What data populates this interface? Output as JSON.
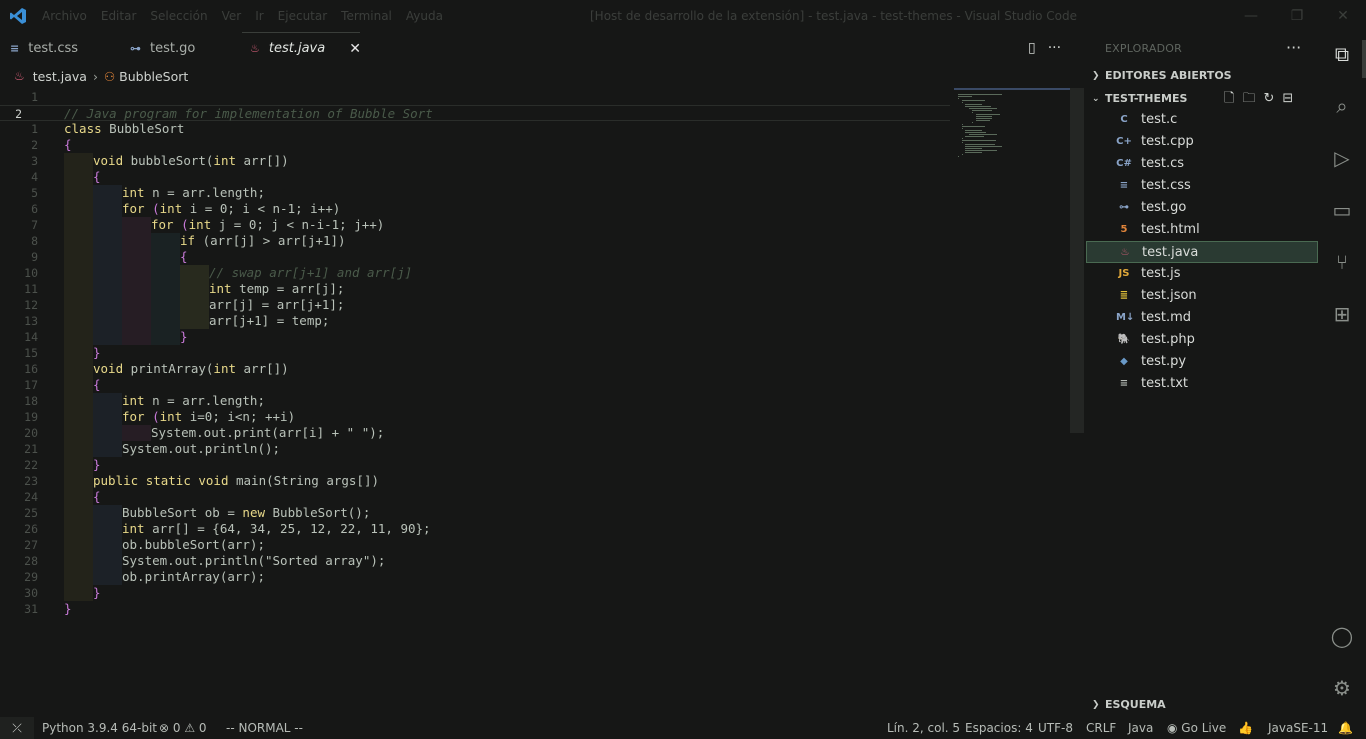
{
  "titlebar": {
    "menu": [
      "Archivo",
      "Editar",
      "Selección",
      "Ver",
      "Ir",
      "Ejecutar",
      "Terminal",
      "Ayuda"
    ],
    "title": "[Host de desarrollo de la extensión] - test.java - test-themes - Visual Studio Code",
    "min": "—",
    "max": "❐",
    "close": "✕"
  },
  "tabs": [
    {
      "label": "test.css",
      "icon": "≡"
    },
    {
      "label": "test.go",
      "icon": "⊶"
    },
    {
      "label": "test.java",
      "icon": "♨",
      "close": "✕"
    }
  ],
  "editor_actions": {
    "split": "▯",
    "more": "···"
  },
  "breadcrumb": {
    "file": "test.java",
    "symbol": "BubbleSort",
    "sep": "›"
  },
  "code": {
    "lines": [
      {
        "n": "1",
        "t": ""
      },
      {
        "n": "2",
        "t": "// Java program for implementation of Bubble Sort"
      },
      {
        "n": "1",
        "t": "class BubbleSort"
      },
      {
        "n": "2",
        "t": "{"
      },
      {
        "n": "3",
        "t": "    void bubbleSort(int arr[])"
      },
      {
        "n": "4",
        "t": "    {"
      },
      {
        "n": "5",
        "t": "        int n = arr.length;"
      },
      {
        "n": "6",
        "t": "        for (int i = 0; i < n-1; i++)"
      },
      {
        "n": "7",
        "t": "            for (int j = 0; j < n-i-1; j++)"
      },
      {
        "n": "8",
        "t": "                if (arr[j] > arr[j+1])"
      },
      {
        "n": "9",
        "t": "                {"
      },
      {
        "n": "10",
        "t": "                    // swap arr[j+1] and arr[j]"
      },
      {
        "n": "11",
        "t": "                    int temp = arr[j];"
      },
      {
        "n": "12",
        "t": "                    arr[j] = arr[j+1];"
      },
      {
        "n": "13",
        "t": "                    arr[j+1] = temp;"
      },
      {
        "n": "14",
        "t": "                }"
      },
      {
        "n": "15",
        "t": "    }"
      },
      {
        "n": "16",
        "t": "    void printArray(int arr[])"
      },
      {
        "n": "17",
        "t": "    {"
      },
      {
        "n": "18",
        "t": "        int n = arr.length;"
      },
      {
        "n": "19",
        "t": "        for (int i=0; i<n; ++i)"
      },
      {
        "n": "20",
        "t": "            System.out.print(arr[i] + \" \");"
      },
      {
        "n": "21",
        "t": "        System.out.println();"
      },
      {
        "n": "22",
        "t": "    }"
      },
      {
        "n": "23",
        "t": "    public static void main(String args[])"
      },
      {
        "n": "24",
        "t": "    {"
      },
      {
        "n": "25",
        "t": "        BubbleSort ob = new BubbleSort();"
      },
      {
        "n": "26",
        "t": "        int arr[] = {64, 34, 25, 12, 22, 11, 90};"
      },
      {
        "n": "27",
        "t": "        ob.bubbleSort(arr);"
      },
      {
        "n": "28",
        "t": "        System.out.println(\"Sorted array\");"
      },
      {
        "n": "29",
        "t": "        ob.printArray(arr);"
      },
      {
        "n": "30",
        "t": "    }"
      },
      {
        "n": "31",
        "t": "}"
      }
    ]
  },
  "sidebar": {
    "title": "EXPLORADOR",
    "more": "···",
    "open_editors": "EDITORES ABIERTOS",
    "workspace": "TEST-THEMES",
    "outline": "ESQUEMA",
    "files": [
      {
        "name": "test.c",
        "icon": "C",
        "color": "#8aa4c8"
      },
      {
        "name": "test.cpp",
        "icon": "C+",
        "color": "#8aa4c8"
      },
      {
        "name": "test.cs",
        "icon": "C#",
        "color": "#8aa4c8"
      },
      {
        "name": "test.css",
        "icon": "≡",
        "color": "#8aa4c8"
      },
      {
        "name": "test.go",
        "icon": "⊶",
        "color": "#8aa4c8"
      },
      {
        "name": "test.html",
        "icon": "5",
        "color": "#e0843a"
      },
      {
        "name": "test.java",
        "icon": "♨",
        "color": "#d9607a"
      },
      {
        "name": "test.js",
        "icon": "JS",
        "color": "#e0a83a"
      },
      {
        "name": "test.json",
        "icon": "≣",
        "color": "#e0c03a"
      },
      {
        "name": "test.md",
        "icon": "M↓",
        "color": "#8aa4c8"
      },
      {
        "name": "test.php",
        "icon": "🐘",
        "color": "#8aa4c8"
      },
      {
        "name": "test.py",
        "icon": "◆",
        "color": "#6a9ac8"
      },
      {
        "name": "test.txt",
        "icon": "≡",
        "color": "#b7bcb7"
      }
    ]
  },
  "activity": {
    "explorer": "⧉",
    "search": "⌕",
    "run": "▷",
    "remote": "▭",
    "scm": "⑂",
    "extensions": "⊞",
    "account": "◯",
    "settings": "⚙"
  },
  "status": {
    "remote": "⤫",
    "python": "Python 3.9.4 64-bit",
    "problems": "⊗ 0 ⚠ 0",
    "mode": "-- NORMAL --",
    "position": "Lín. 2, col. 5",
    "spaces": "Espacios: 4",
    "encoding": "UTF-8",
    "eol": "CRLF",
    "language": "Java",
    "golive": "◉ Go Live",
    "thumb": "👍",
    "java": "JavaSE-11",
    "bell": "🔔"
  }
}
